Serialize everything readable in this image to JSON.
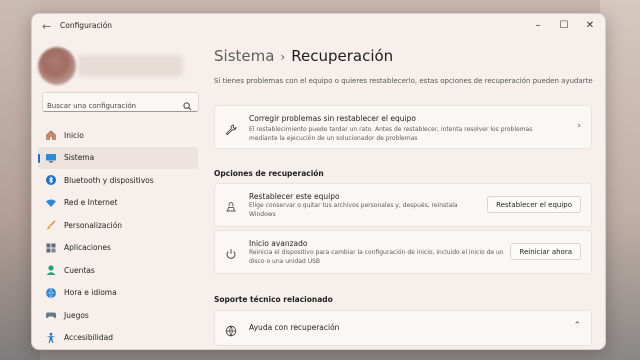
{
  "window": {
    "title": "Configuración"
  },
  "search": {
    "placeholder": "Buscar una configuración"
  },
  "sidebar": {
    "items": [
      {
        "label": "Inicio",
        "icon": "home-icon"
      },
      {
        "label": "Sistema",
        "icon": "monitor-icon",
        "active": true
      },
      {
        "label": "Bluetooth y dispositivos",
        "icon": "bluetooth-icon"
      },
      {
        "label": "Red e Internet",
        "icon": "wifi-icon"
      },
      {
        "label": "Personalización",
        "icon": "brush-icon"
      },
      {
        "label": "Aplicaciones",
        "icon": "apps-icon"
      },
      {
        "label": "Cuentas",
        "icon": "person-icon"
      },
      {
        "label": "Hora e idioma",
        "icon": "globe-clock-icon"
      },
      {
        "label": "Juegos",
        "icon": "gamepad-icon"
      },
      {
        "label": "Accesibilidad",
        "icon": "accessibility-icon"
      }
    ]
  },
  "breadcrumb": {
    "parent": "Sistema",
    "separator": "›",
    "current": "Recuperación"
  },
  "subtitle": "Si tienes problemas con el equipo o quieres restablecerlo, estas opciones de recuperación pueden ayudarte",
  "fix_card": {
    "title": "Corregir problemas sin restablecer el equipo",
    "description": "El restablecimiento puede tardar un rato. Antes de restablecer, intenta resolver los problemas mediante la ejecución de un solucionador de problemas"
  },
  "recovery_section": {
    "title": "Opciones de recuperación"
  },
  "reset_card": {
    "title": "Restablecer este equipo",
    "description": "Elige conservar o quitar tus archivos personales y, después, reinstala Windows",
    "button": "Restablecer el equipo"
  },
  "advanced_card": {
    "title": "Inicio avanzado",
    "description": "Reinicia el dispositivo para cambiar la configuración de inicio, incluido el inicio de un disco o una unidad USB",
    "button": "Reiniciar ahora"
  },
  "support_section": {
    "title": "Soporte técnico relacionado"
  },
  "help_card": {
    "title": "Ayuda con recuperación"
  },
  "colors": {
    "accent": "#1a6fc9",
    "window_bg": "#f7efeb",
    "card_bg": "#fbf7f5"
  }
}
